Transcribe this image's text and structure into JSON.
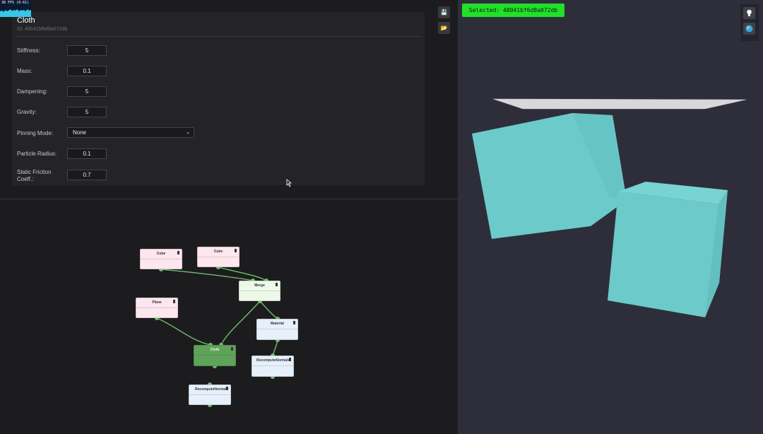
{
  "fps": {
    "label": "38 FPS (0-61)"
  },
  "properties": {
    "title": "Cloth",
    "id_text": "ID: 48041bf6d8a072db",
    "fields": [
      {
        "label": "Stiffness:",
        "value": "5"
      },
      {
        "label": "Mass:",
        "value": "0.1"
      },
      {
        "label": "Dampening:",
        "value": "5"
      },
      {
        "label": "Gravity:",
        "value": "5"
      },
      {
        "label": "Pinning Mode:",
        "value": "None"
      },
      {
        "label": "Particle Radius:",
        "value": "0.1"
      },
      {
        "label": "Static Friction Coeff.:",
        "value": "0.7"
      }
    ]
  },
  "toolbar": {
    "save_icon": "save-icon",
    "open_icon": "folder-open-icon"
  },
  "graph": {
    "nodes": [
      {
        "title": "Cube"
      },
      {
        "title": "Cube"
      },
      {
        "title": "Merge"
      },
      {
        "title": "Plane"
      },
      {
        "title": "Material"
      },
      {
        "title": "Cloth"
      },
      {
        "title": "RecomputeNormals"
      },
      {
        "title": "RecomputeNormals"
      }
    ]
  },
  "viewport": {
    "selected_label": "Selected: 48041bf6d8a072db",
    "light_icon": "lightbulb-icon",
    "sphere_icon": "sphere-icon"
  },
  "colors": {
    "accent": "#22e02a",
    "cube": "#6ccaca",
    "wire": "#6fbf6a"
  }
}
